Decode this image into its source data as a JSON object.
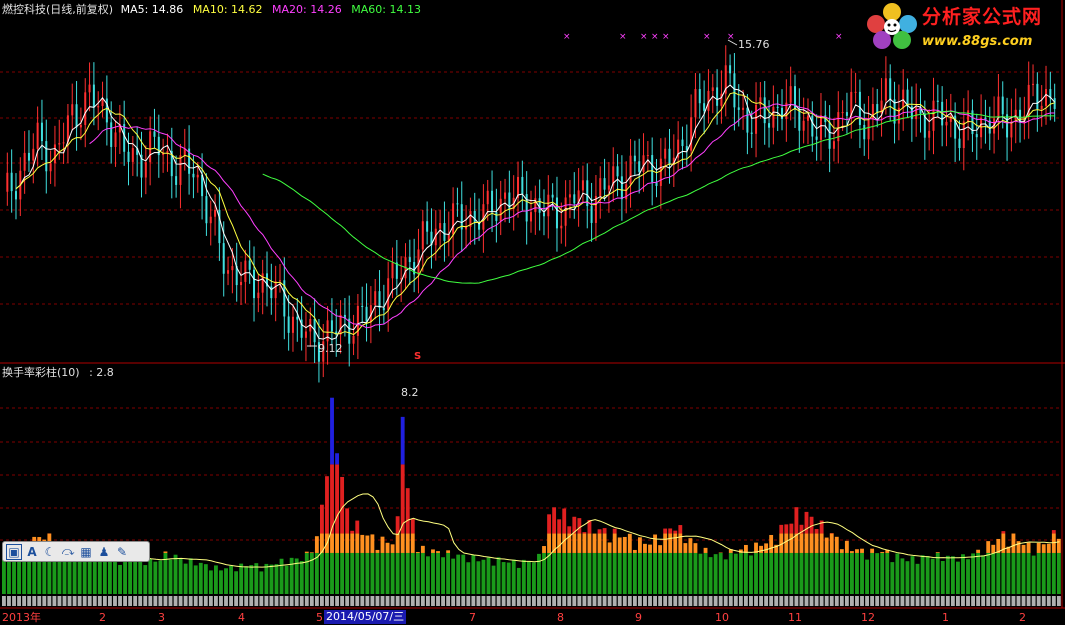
{
  "price_header": {
    "title": "燃控科技(日线,前复权)",
    "ma5": "MA5: 14.86",
    "ma10": "MA10: 14.62",
    "ma20": "MA20: 14.26",
    "ma60": "MA60: 14.13"
  },
  "indicator_header": {
    "name": "换手率彩柱(10)",
    "value": ": 2.8"
  },
  "annotations": {
    "high_label": "15.76",
    "low_label": "9.12",
    "peak_label": "8.2",
    "signal_mark": "S",
    "cross_mark": "×"
  },
  "logo": {
    "text": "分析家公式网",
    "url": "www.88gs.com"
  },
  "x_axis": {
    "labels": [
      "2013年",
      "2",
      "3",
      "4",
      "5",
      "7",
      "8",
      "9",
      "10",
      "11",
      "12",
      "1",
      "2"
    ],
    "selected_date": "2014/05/07/三"
  },
  "toolbar": {
    "icons": [
      "frame-icon",
      "text-icon",
      "moon-icon",
      "arrow-icon",
      "keyboard-icon",
      "user-icon",
      "wrench-icon"
    ],
    "glyphs": [
      "▣",
      "A",
      "☾",
      "⤼",
      "▦",
      "♟",
      "✎"
    ]
  },
  "colors": {
    "up": "#ff3030",
    "down": "#40e0e0",
    "ma5": "#ffffff",
    "ma10": "#ffff40",
    "ma20": "#ff40ff",
    "ma60": "#40ff40",
    "grid": "#800000"
  },
  "chart_data": [
    {
      "type": "candlestick",
      "title": "燃控科技(日线,前复权)",
      "series": [
        {
          "name": "MA5",
          "last": 14.86
        },
        {
          "name": "MA10",
          "last": 14.62
        },
        {
          "name": "MA20",
          "last": 14.26
        },
        {
          "name": "MA60",
          "last": 14.13
        }
      ],
      "close_approx": [
        12.6,
        13.3,
        14.0,
        13.6,
        14.6,
        15.0,
        14.6,
        13.7,
        13.6,
        13.9,
        13.3,
        13.4,
        12.1,
        11.0,
        10.7,
        10.7,
        10.3,
        9.6,
        9.3,
        9.5,
        9.7,
        9.9,
        10.5,
        10.9,
        11.5,
        11.9,
        12.1,
        12.2,
        12.3,
        12.7,
        12.6,
        12.4,
        12.3,
        12.7,
        12.6,
        13.0,
        13.2,
        13.5,
        13.3,
        13.8,
        14.7,
        15.2,
        15.3,
        14.4,
        14.6,
        14.8,
        14.7,
        14.1,
        14.3,
        14.9,
        14.4,
        15.1,
        14.8,
        14.5,
        14.6,
        14.3,
        14.2,
        14.6,
        14.4,
        14.8,
        15.1,
        15.0
      ],
      "annotations": {
        "high": 15.76,
        "low": 9.12
      }
    },
    {
      "type": "bar",
      "title": "换手率彩柱(10)",
      "value": 2.8,
      "peak": 8.2,
      "values_approx": [
        1.9,
        2.0,
        2.3,
        2.6,
        2.1,
        1.8,
        1.7,
        1.9,
        1.6,
        1.5,
        1.6,
        1.4,
        1.8,
        1.5,
        1.4,
        1.2,
        1.1,
        1.2,
        1.3,
        1.2,
        1.4,
        1.5,
        1.6,
        2.6,
        8.2,
        3.6,
        2.8,
        2.4,
        2.3,
        2.2,
        2.0,
        1.9,
        1.8,
        1.7,
        1.6,
        1.5,
        1.5,
        1.4,
        1.4,
        1.5,
        3.8,
        3.4,
        3.2,
        2.9,
        2.7,
        2.6,
        2.4,
        2.2,
        2.6,
        3.0,
        2.4,
        1.9,
        1.7,
        1.8,
        2.0,
        2.1,
        2.4,
        3.0,
        3.6,
        3.3,
        2.8,
        2.3,
        2.0,
        1.8,
        1.9,
        1.7,
        1.5,
        1.6,
        1.7,
        1.6,
        1.6,
        1.8,
        2.2,
        2.6,
        2.4,
        2.0,
        2.2,
        2.8
      ]
    }
  ]
}
